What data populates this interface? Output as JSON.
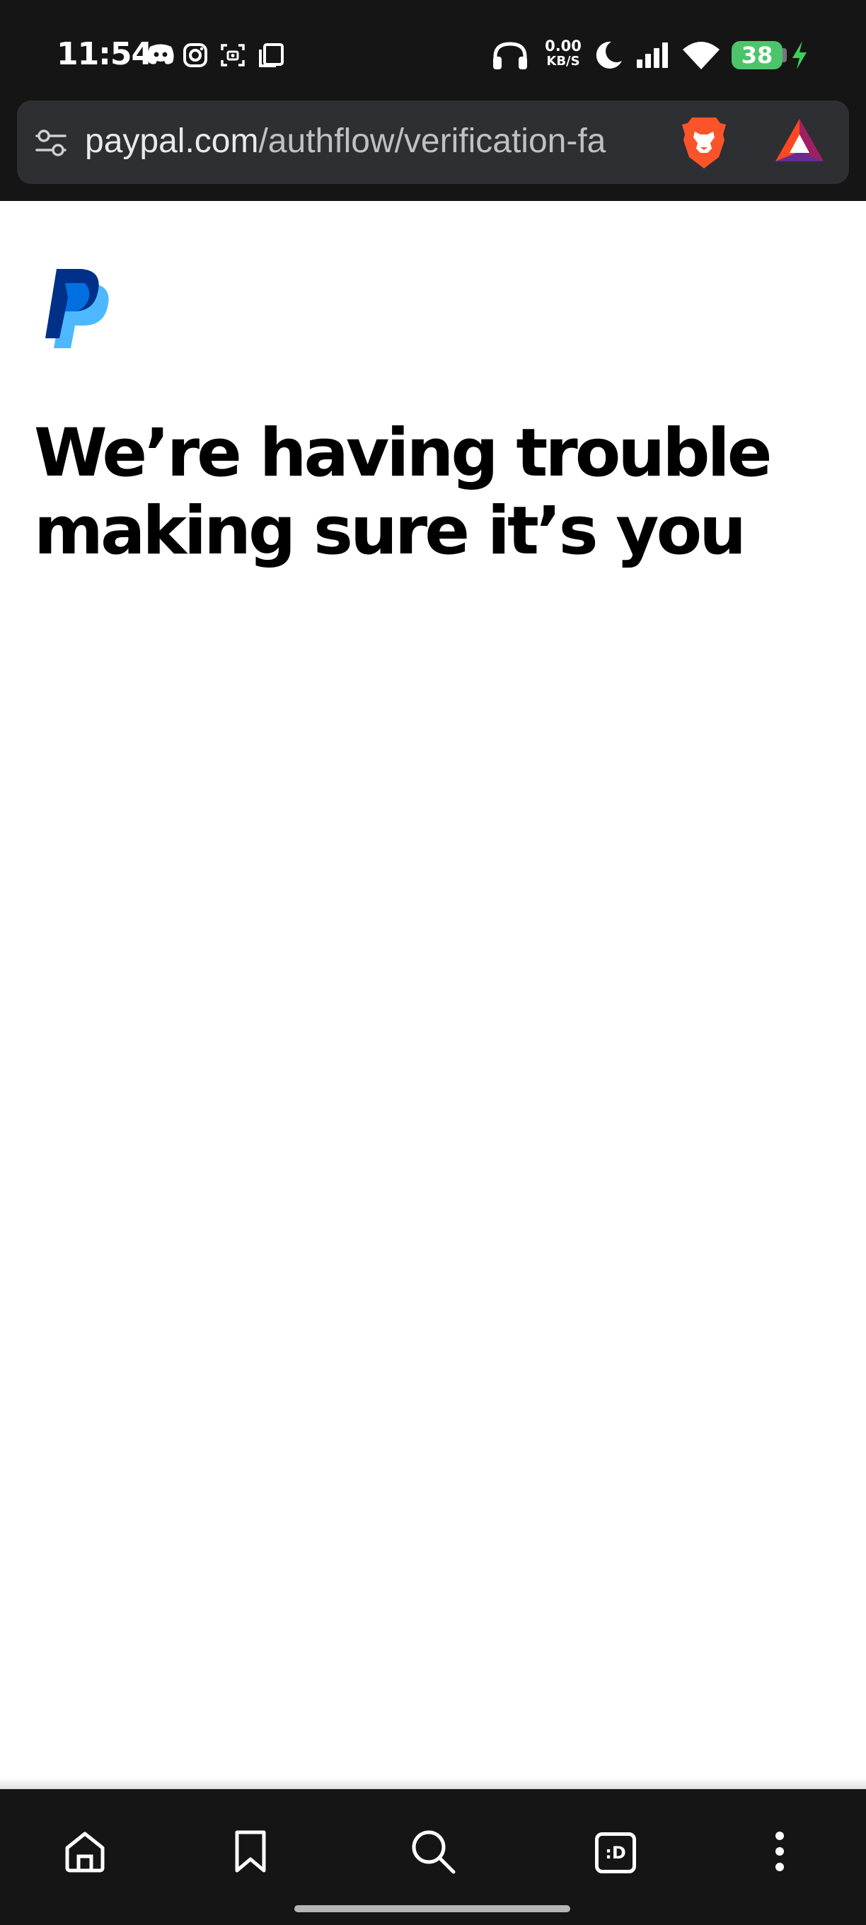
{
  "status_bar": {
    "time": "11:54",
    "net_speed_value": "0.00",
    "net_speed_unit": "KB/S",
    "battery_level": "38",
    "notification_icons": [
      "discord-icon",
      "instagram-icon",
      "screenshot-icon",
      "copy-icon"
    ],
    "system_icons": [
      "headphones-icon",
      "moon-icon",
      "signal-icon",
      "wifi-icon",
      "charging-icon"
    ]
  },
  "browser": {
    "url_host": "paypal.com",
    "url_path": "/authflow/verification-fa",
    "toolbar_icons": [
      "home-icon",
      "bookmark-icon",
      "search-icon",
      "tabs-icon",
      "menu-icon"
    ],
    "tabs_label": ":D"
  },
  "page": {
    "title": "We’re having trouble making sure it’s you"
  },
  "colors": {
    "paypal_dark": "#003087",
    "paypal_light": "#4db8ff",
    "brave_orange": "#fb542b",
    "battery_green": "#4cc46b",
    "chrome_bg": "#151515"
  }
}
